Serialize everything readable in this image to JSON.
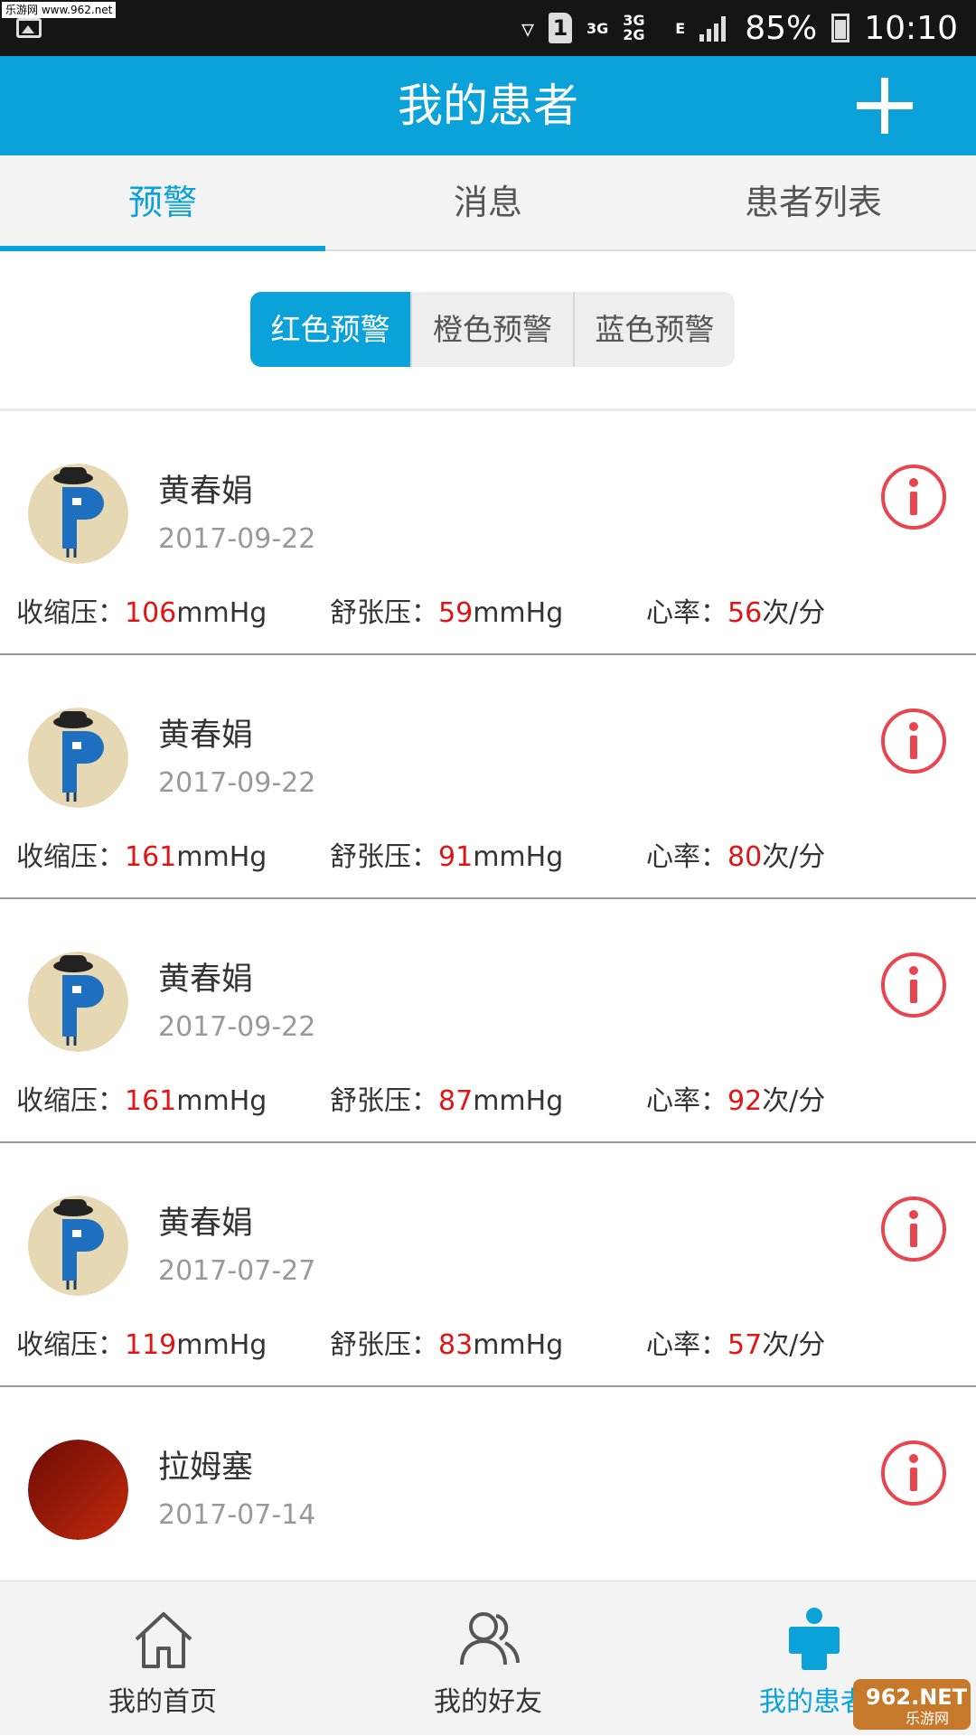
{
  "status_bar": {
    "watermark": "乐游网 www.962.net",
    "network_3g": "3G",
    "network_3g2g": "3G 2G",
    "network_e": "E",
    "sim_slot": "1",
    "battery": "85%",
    "time": "10:10"
  },
  "header": {
    "title": "我的患者",
    "add_icon": "plus-icon"
  },
  "tabs": [
    {
      "label": "预警",
      "active": true
    },
    {
      "label": "消息",
      "active": false
    },
    {
      "label": "患者列表",
      "active": false
    }
  ],
  "alert_levels": [
    {
      "label": "红色预警",
      "active": true
    },
    {
      "label": "橙色预警",
      "active": false
    },
    {
      "label": "蓝色预警",
      "active": false
    }
  ],
  "metric_labels": {
    "systolic": "收缩压：",
    "diastolic": "舒张压：",
    "heart_rate": "心率：",
    "pressure_unit": "mmHg",
    "rate_unit": "次/分"
  },
  "patients": [
    {
      "name": "黄春娟",
      "date": "2017-09-22",
      "systolic": "106",
      "diastolic": "59",
      "heart_rate": "56",
      "avatar": "p-mascot"
    },
    {
      "name": "黄春娟",
      "date": "2017-09-22",
      "systolic": "161",
      "diastolic": "91",
      "heart_rate": "80",
      "avatar": "p-mascot"
    },
    {
      "name": "黄春娟",
      "date": "2017-09-22",
      "systolic": "161",
      "diastolic": "87",
      "heart_rate": "92",
      "avatar": "p-mascot"
    },
    {
      "name": "黄春娟",
      "date": "2017-07-27",
      "systolic": "119",
      "diastolic": "83",
      "heart_rate": "57",
      "avatar": "p-mascot"
    },
    {
      "name": "拉姆塞",
      "date": "2017-07-14",
      "systolic": "",
      "diastolic": "",
      "heart_rate": "",
      "avatar": "red-circle"
    }
  ],
  "bottom_nav": [
    {
      "label": "我的首页",
      "icon": "home-icon",
      "active": false
    },
    {
      "label": "我的好友",
      "icon": "friends-icon",
      "active": false
    },
    {
      "label": "我的患者",
      "icon": "patient-icon",
      "active": true
    }
  ],
  "brand_mark": {
    "line1": "962.NET",
    "line2": "乐游网"
  },
  "colors": {
    "primary": "#0aa2d8",
    "alert_red": "#e01616",
    "info_icon_red": "#e8464f",
    "header_text": "#ffffff"
  }
}
